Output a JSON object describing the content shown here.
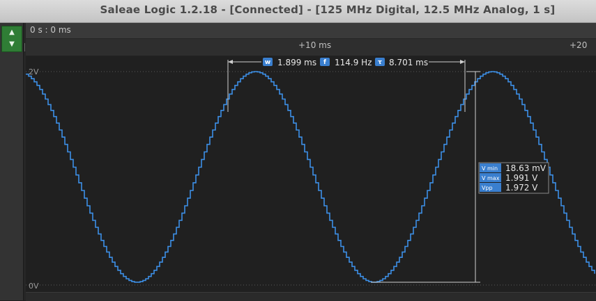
{
  "window": {
    "title": "Saleae Logic 1.2.18 - [Connected] - [125 MHz Digital, 12.5 MHz Analog, 1 s]"
  },
  "navigation": {
    "up_icon": "up-arrow-icon",
    "down_icon": "down-arrow-icon"
  },
  "ruler": {
    "cursor_position": "0 s : 0 ms",
    "tick_10": "+10 ms",
    "tick_20": "+20"
  },
  "channel": {
    "level_high": "2V",
    "level_low": "0V",
    "trace_color": "#3d8fe6"
  },
  "width_measurement": {
    "w_badge": "w",
    "w_value": "1.899 ms",
    "f_badge": "f",
    "f_value": "114.9 Hz",
    "t_badge": "τ",
    "t_value": "8.701 ms"
  },
  "voltage_measurement": {
    "vmin_label": "V min",
    "vmin_value": "18.63 mV",
    "vmax_label": "V max",
    "vmax_value": "1.991 V",
    "vpp_label": "Vpp",
    "vpp_value": "1.972 V"
  },
  "colors": {
    "accent": "#3d8fe6",
    "nav_green": "#2f7d35",
    "badge_blue": "#3a7fcf"
  }
}
